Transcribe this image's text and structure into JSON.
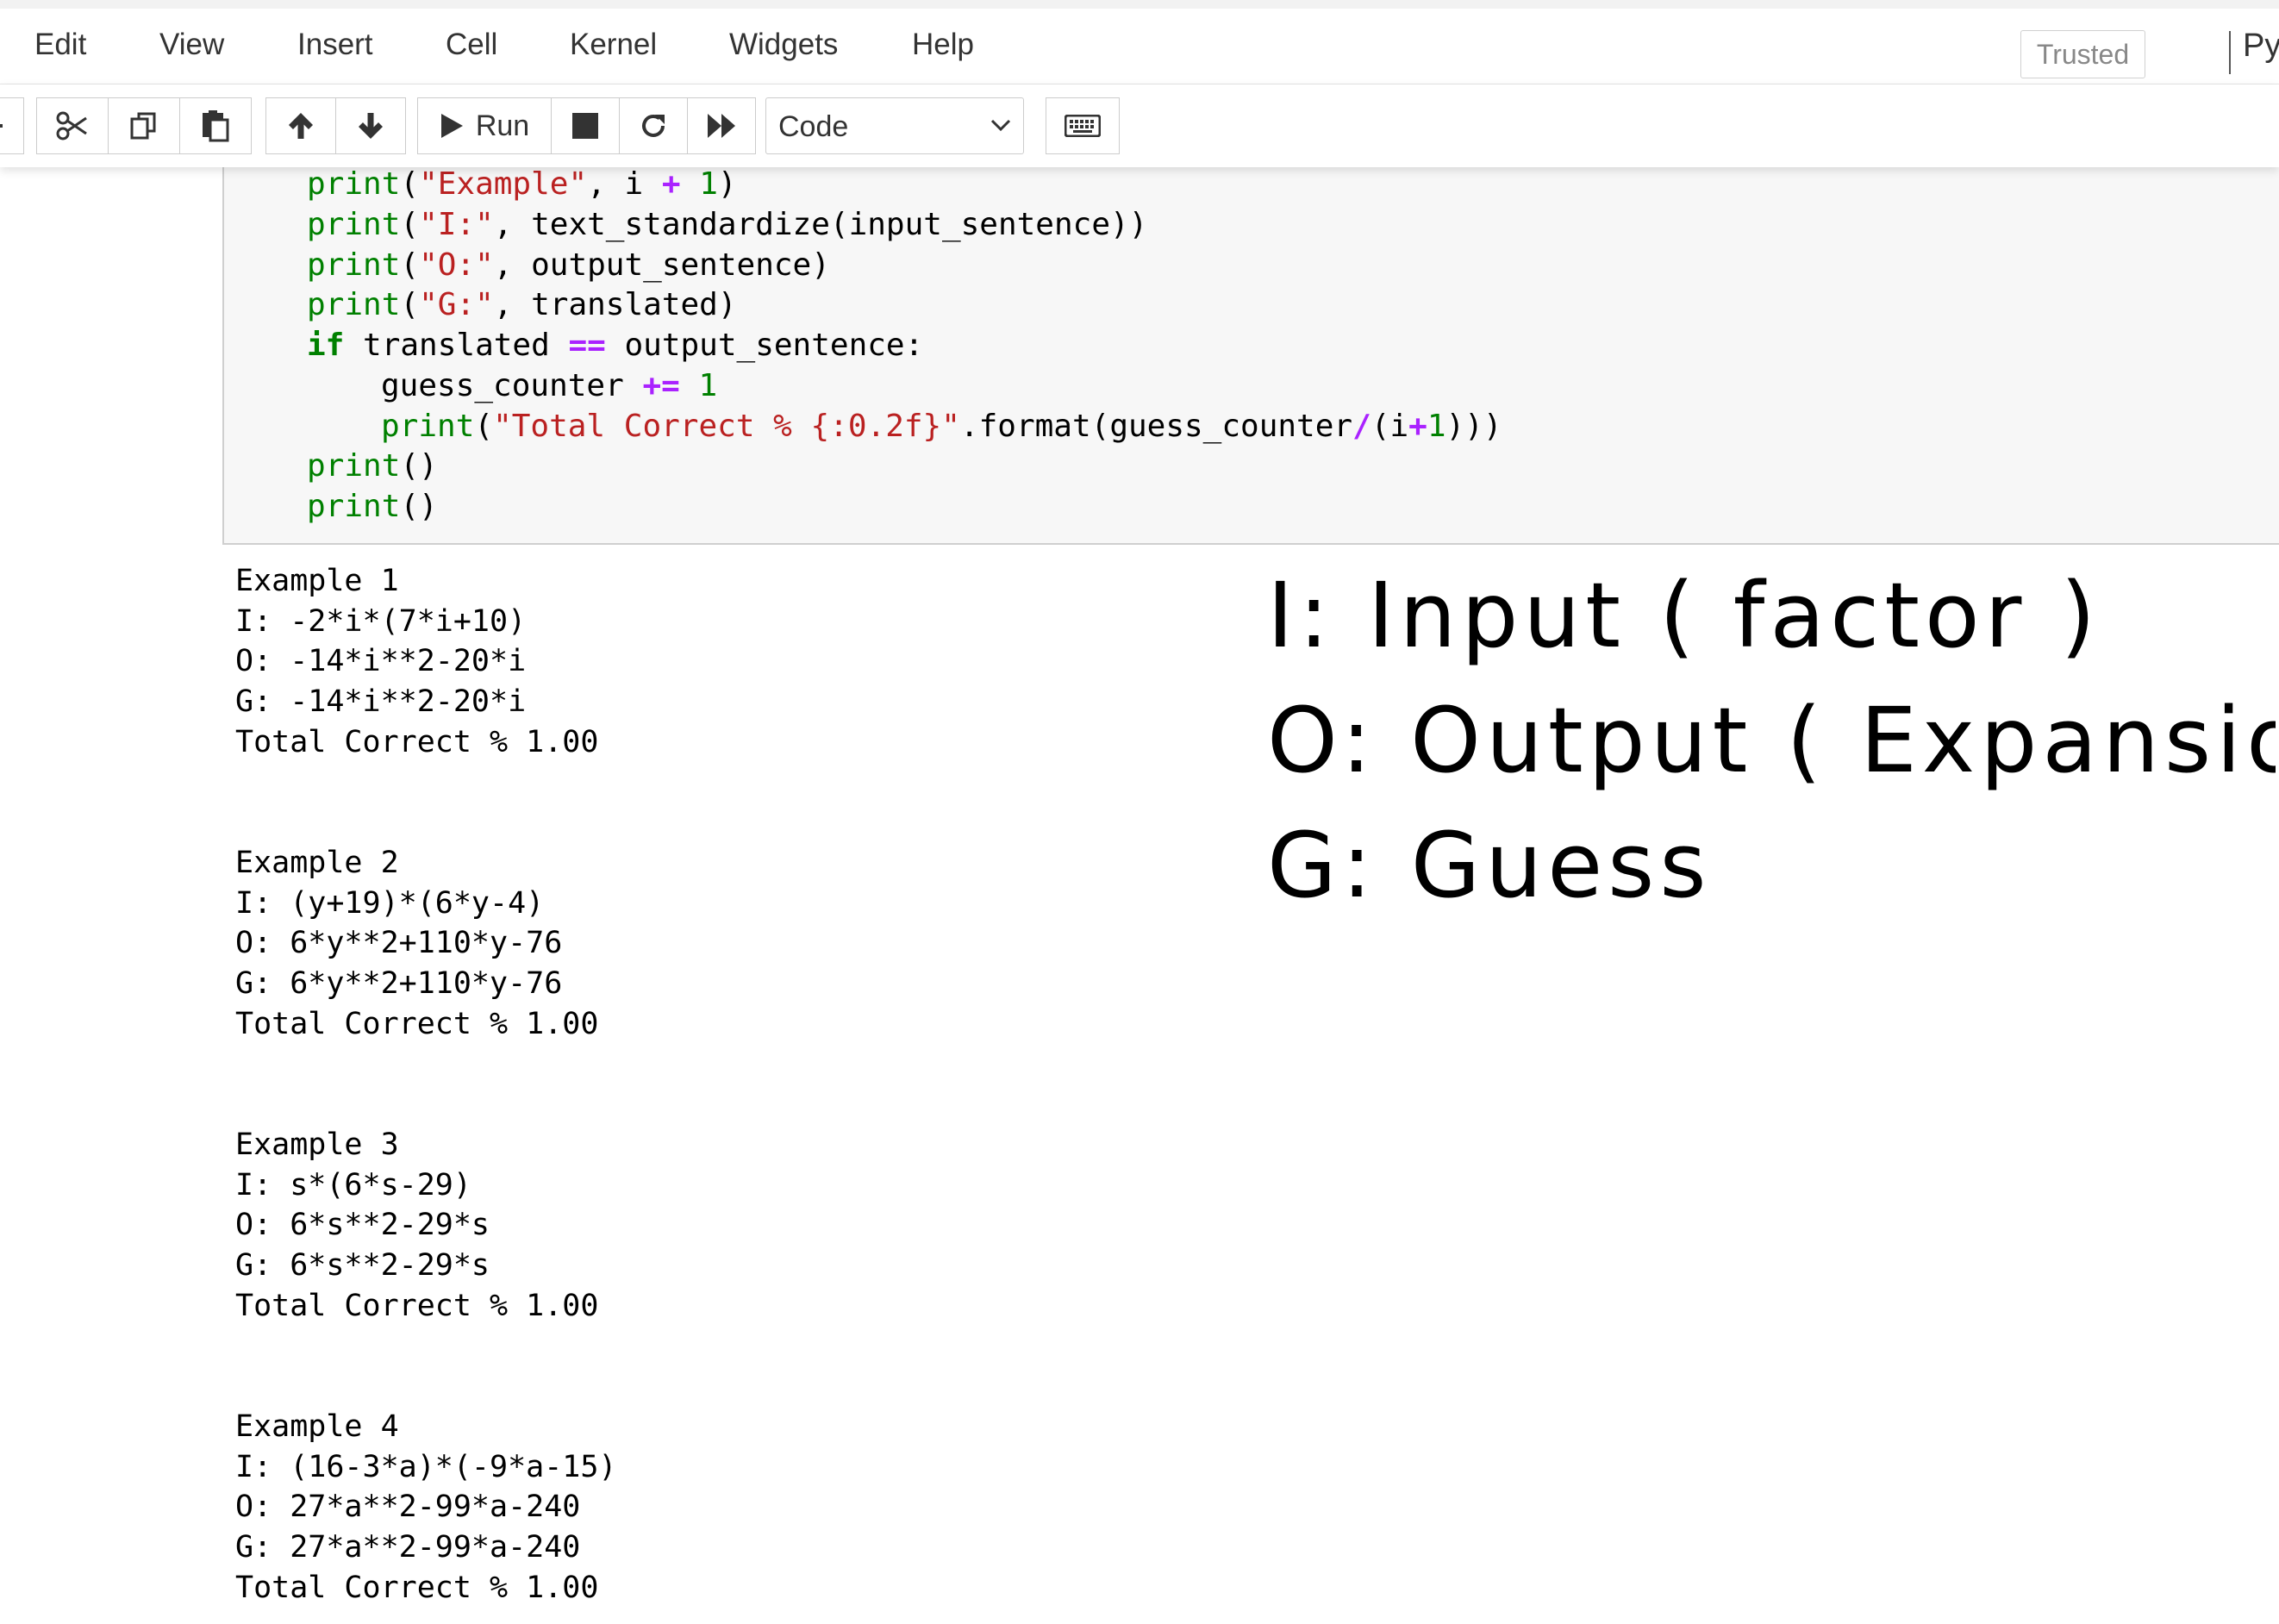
{
  "menu": {
    "items": [
      "Edit",
      "View",
      "Insert",
      "Cell",
      "Kernel",
      "Widgets",
      "Help"
    ],
    "trusted_label": "Trusted",
    "kernel_partial": "Py"
  },
  "toolbar": {
    "run_label": "Run",
    "cell_type": "Code"
  },
  "code": {
    "lines": [
      "    print(\"Example\", i + 1)",
      "    print(\"I:\", text_standardize(input_sentence))",
      "    print(\"O:\", output_sentence)",
      "    print(\"G:\", translated)",
      "    if translated == output_sentence:",
      "        guess_counter += 1",
      "        print(\"Total Correct % {:0.2f}\".format(guess_counter/(i+1)))",
      "    print()",
      "    print()"
    ]
  },
  "output": {
    "examples": [
      {
        "title": "Example 1",
        "input": "I: -2*i*(7*i+10)",
        "output": "O: -14*i**2-20*i",
        "guess": "G: -14*i**2-20*i",
        "total": "Total Correct % 1.00"
      },
      {
        "title": "Example 2",
        "input": "I: (y+19)*(6*y-4)",
        "output": "O: 6*y**2+110*y-76",
        "guess": "G: 6*y**2+110*y-76",
        "total": "Total Correct % 1.00"
      },
      {
        "title": "Example 3",
        "input": "I: s*(6*s-29)",
        "output": "O: 6*s**2-29*s",
        "guess": "G: 6*s**2-29*s",
        "total": "Total Correct % 1.00"
      },
      {
        "title": "Example 4",
        "input": "I: (16-3*a)*(-9*a-15)",
        "output": "O: 27*a**2-99*a-240",
        "guess": "G: 27*a**2-99*a-240",
        "total": "Total Correct % 1.00"
      }
    ]
  },
  "annotation": {
    "line1": "I: Input ( factor )",
    "line2": "O: Output ( Expansion )",
    "line3": "G: Guess"
  }
}
